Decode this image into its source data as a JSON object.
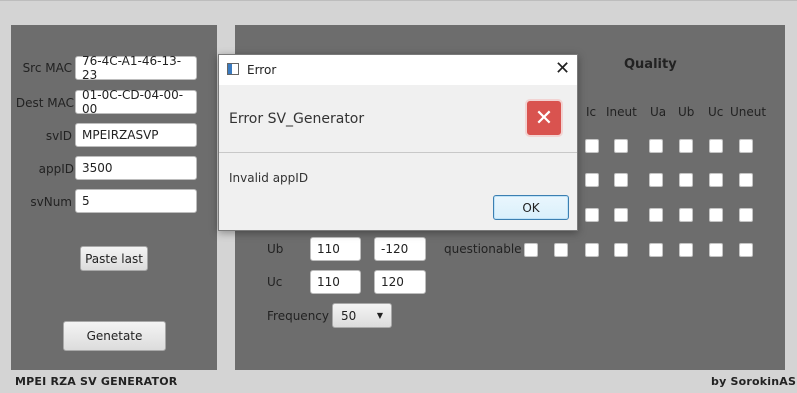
{
  "form": {
    "src_mac_label": "Src MAC",
    "src_mac_value": "76-4C-A1-46-13-23",
    "dest_mac_label": "Dest MAC",
    "dest_mac_value": "01-0C-CD-04-00-00",
    "svid_label": "svID",
    "svid_value": "MPEIRZASVP",
    "appid_label": "appID",
    "appid_value": "3500",
    "svnum_label": "svNum",
    "svnum_value": "5",
    "paste_last_label": "Paste last",
    "generate_label": "Genetate"
  },
  "quality": {
    "title": "Quality",
    "columns": [
      "Ic",
      "Ineut",
      "Ua",
      "Ub",
      "Uc",
      "Uneut"
    ],
    "row_label_questionable": "questionable"
  },
  "signals": {
    "ub_label": "Ub",
    "ub_amplitude": "110",
    "ub_angle": "-120",
    "uc_label": "Uc",
    "uc_amplitude": "110",
    "uc_angle": "120",
    "frequency_label": "Frequency",
    "frequency_value": "50"
  },
  "footer": {
    "left": "MPEI RZA SV GENERATOR",
    "right": "by SorokinAS"
  },
  "dialog": {
    "title": "Error",
    "header": "Error SV_Generator",
    "message": "Invalid appID",
    "ok_label": "OK",
    "error_color": "#d9534f"
  }
}
